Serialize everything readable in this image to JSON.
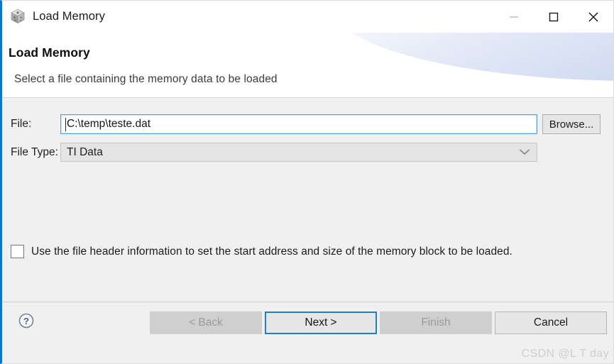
{
  "window": {
    "title": "Load Memory",
    "icon": "cube-icon",
    "accent_color": "#0078d7",
    "controls": {
      "minimize": "minimize-icon",
      "maximize": "maximize-icon",
      "close": "close-icon"
    }
  },
  "header": {
    "title": "Load Memory",
    "description": "Select a file containing the memory data to be loaded"
  },
  "form": {
    "file": {
      "label": "File:",
      "value": "C:\\temp\\teste.dat",
      "placeholder": ""
    },
    "browse_label": "Browse...",
    "file_type": {
      "label": "File Type:",
      "selected": "TI Data",
      "options": [
        "TI Data"
      ],
      "chevron": "chevron-down-icon"
    },
    "header_info_checkbox": {
      "label": "Use the file header information to set the start address and size of the memory block to be loaded.",
      "checked": false
    }
  },
  "footer": {
    "help": "help-icon",
    "buttons": {
      "back": "< Back",
      "next": "Next >",
      "finish": "Finish",
      "cancel": "Cancel"
    }
  },
  "watermark": "CSDN @L T day"
}
